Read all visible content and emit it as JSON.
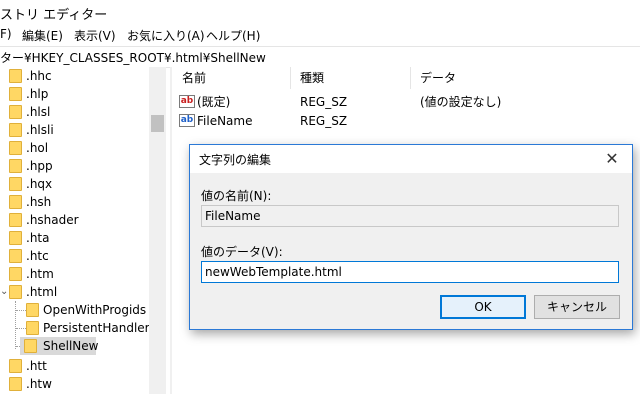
{
  "window": {
    "title": "ストリ エディター"
  },
  "menu": {
    "file": "F)",
    "edit": "編集(E)",
    "view": "表示(V)",
    "favorites": "お気に入り(A)",
    "help": "ヘルプ(H)"
  },
  "address": {
    "path": "ター¥HKEY_CLASSES_ROOT¥.html¥ShellNew"
  },
  "tree": {
    "items": [
      ".hhc",
      ".hlp",
      ".hlsl",
      ".hlsli",
      ".hol",
      ".hpp",
      ".hqx",
      ".hsh",
      ".hshader",
      ".hta",
      ".htc",
      ".htm",
      ".html"
    ],
    "children": [
      "OpenWithProgids",
      "PersistentHandler",
      "ShellNew"
    ],
    "after": [
      ".htt",
      ".htw"
    ],
    "expander": "⌄"
  },
  "list": {
    "headers": {
      "name": "名前",
      "type": "種類",
      "data": "データ"
    },
    "rows": [
      {
        "name": "(既定)",
        "type": "REG_SZ",
        "data": "(値の設定なし)",
        "icon": "ab"
      },
      {
        "name": "FileName",
        "type": "REG_SZ",
        "data": "",
        "icon": "ab"
      }
    ]
  },
  "dialog": {
    "title": "文字列の編集",
    "close": "✕",
    "name_label": "値の名前(N):",
    "name_value": "FileName",
    "data_label": "値のデータ(V):",
    "data_value": "newWebTemplate.html",
    "ok": "OK",
    "cancel": "キャンセル"
  }
}
